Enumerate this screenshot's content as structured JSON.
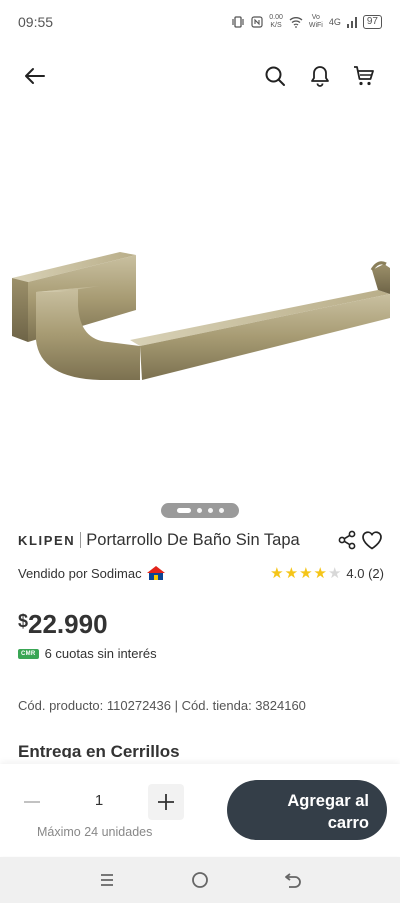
{
  "status_bar": {
    "time": "09:55",
    "net_speed_value": "0.00",
    "net_speed_unit": "K/S",
    "vowifi_top": "Vo",
    "vowifi_bottom": "WiFi",
    "network_label": "4G",
    "battery": "97"
  },
  "icons": {
    "back": "arrow-left-icon",
    "search": "search-icon",
    "notifications": "bell-icon",
    "cart": "cart-icon",
    "share": "share-icon",
    "favorite": "heart-icon"
  },
  "product": {
    "brand": "KLIPEN",
    "title": "Portarrollo De Baño Sin Tapa",
    "seller": "Vendido por Sodimac",
    "rating_value": 4.0,
    "rating_text": "4.0 (2)",
    "price_currency": "$",
    "price_amount": "22.990",
    "cmr_badge": "CMR",
    "installments": "6 cuotas sin interés",
    "codes": "Cód. producto: 110272436 | Cód. tienda: 3824160",
    "delivery_heading": "Entrega en Cerrillos",
    "image_count": 4,
    "image_active_index": 0
  },
  "purchase": {
    "quantity": "1",
    "max_note": "Máximo 24 unidades",
    "add_to_cart_line1": "Agregar al",
    "add_to_cart_line2": "carro"
  },
  "colors": {
    "rating_star": "#f5c518",
    "cmr_green": "#3aa655",
    "add_button_bg": "#343e48"
  }
}
